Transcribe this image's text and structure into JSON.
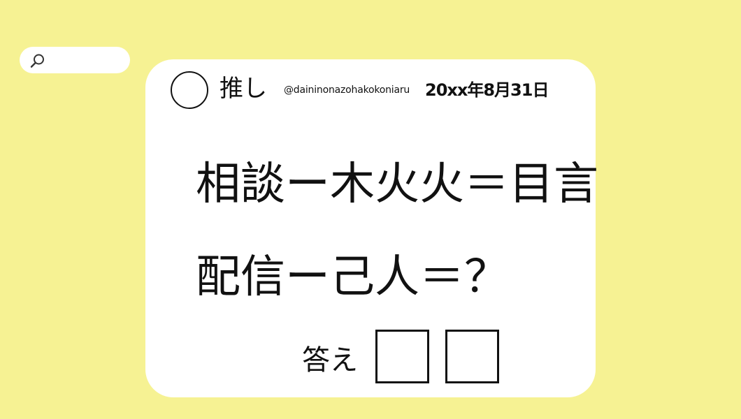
{
  "search": {
    "icon": "search-icon",
    "placeholder": ""
  },
  "post": {
    "avatar_icon": "avatar-circle-icon",
    "display_name": "推し",
    "handle": "@daininonazohakokoniaru",
    "date": "20xx年8月31日"
  },
  "puzzle": {
    "line1": "相談ー木火火＝目言",
    "line2": "配信ー己人＝？",
    "answer_label": "答え",
    "answer_boxes": [
      "",
      ""
    ]
  },
  "colors": {
    "background": "#f6f293",
    "card": "#ffffff",
    "ink": "#111111"
  }
}
